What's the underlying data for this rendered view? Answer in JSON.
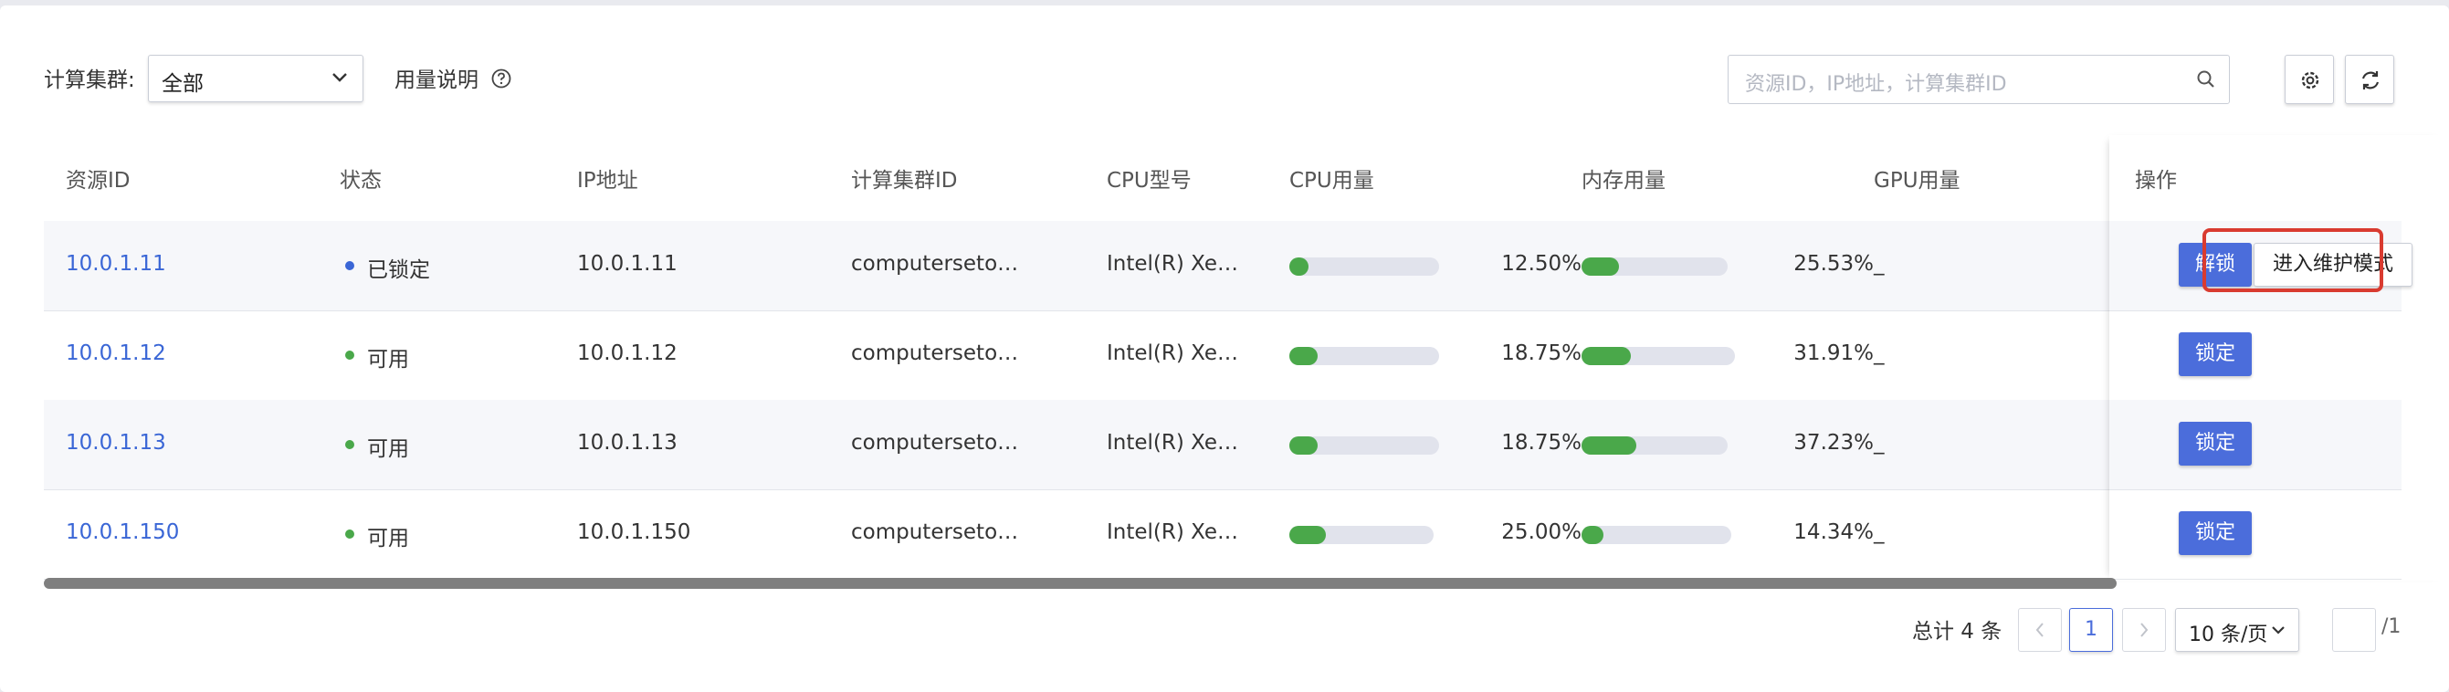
{
  "toolbar": {
    "cluster_label": "计算集群:",
    "cluster_value": "全部",
    "usage_help": "用量说明",
    "search_placeholder": "资源ID，IP地址，计算集群ID"
  },
  "table": {
    "headers": {
      "resource_id": "资源ID",
      "status": "状态",
      "ip": "IP地址",
      "cluster_id": "计算集群ID",
      "cpu_model": "CPU型号",
      "cpu_usage": "CPU用量",
      "mem_usage": "内存用量",
      "gpu_usage": "GPU用量",
      "actions": "操作"
    },
    "rows": [
      {
        "resource_id": "10.0.1.11",
        "status": "已锁定",
        "status_color": "#3a66d6",
        "ip": "10.0.1.11",
        "cluster_id": "computerseto…",
        "cpu_model": "Intel(R) Xe…",
        "cpu_pct": "12.50%",
        "cpu_value": 12.5,
        "mem_pct": "25.53%",
        "mem_value": 25.53,
        "gpu": "_",
        "action_primary": "解锁",
        "action_secondary": "进入维护模式"
      },
      {
        "resource_id": "10.0.1.12",
        "status": "可用",
        "status_color": "#4aa84a",
        "ip": "10.0.1.12",
        "cluster_id": "computerseto…",
        "cpu_model": "Intel(R) Xe…",
        "cpu_pct": "18.75%",
        "cpu_value": 18.75,
        "mem_pct": "31.91%",
        "mem_value": 31.91,
        "gpu": "_",
        "action_primary": "锁定"
      },
      {
        "resource_id": "10.0.1.13",
        "status": "可用",
        "status_color": "#4aa84a",
        "ip": "10.0.1.13",
        "cluster_id": "computerseto…",
        "cpu_model": "Intel(R) Xe…",
        "cpu_pct": "18.75%",
        "cpu_value": 18.75,
        "mem_pct": "37.23%",
        "mem_value": 37.23,
        "gpu": "_",
        "action_primary": "锁定"
      },
      {
        "resource_id": "10.0.1.150",
        "status": "可用",
        "status_color": "#4aa84a",
        "ip": "10.0.1.150",
        "cluster_id": "computerseto…",
        "cpu_model": "Intel(R) Xe…",
        "cpu_pct": "25.00%",
        "cpu_value": 25.0,
        "mem_pct": "14.34%",
        "mem_value": 14.34,
        "gpu": "_",
        "action_primary": "锁定"
      }
    ]
  },
  "pagination": {
    "total": "总计 4 条",
    "current_page": "1",
    "page_size": "10 条/页",
    "page_count": "/1"
  },
  "colors": {
    "primary": "#4b6ddb",
    "link": "#3a66d6",
    "success": "#4aa84a",
    "highlight": "#d93b30"
  }
}
